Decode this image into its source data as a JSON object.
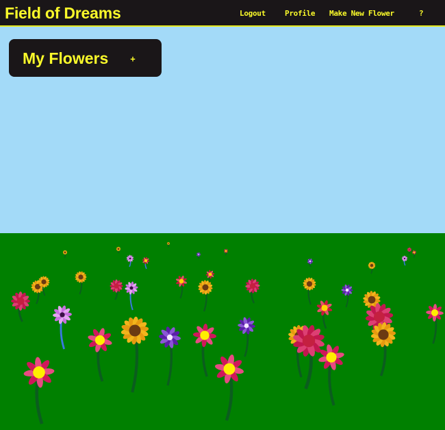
{
  "header": {
    "title": "Field of Dreams",
    "nav": {
      "logout": "Logout",
      "profile": "Profile",
      "make_new_flower": "Make New Flower",
      "help": "?"
    }
  },
  "panel": {
    "title": "My Flowers",
    "add_label": "+"
  },
  "colors": {
    "accent": "#fbfb2a",
    "bar": "#1a1618",
    "sky": "#a3daf8",
    "grass": "#008000"
  },
  "field": {
    "flower_icons": [
      "sunflower-icon",
      "pink-daisy-icon",
      "purple-pinwheel-icon",
      "lilac-flower-icon",
      "red-dot-flower-icon"
    ]
  }
}
